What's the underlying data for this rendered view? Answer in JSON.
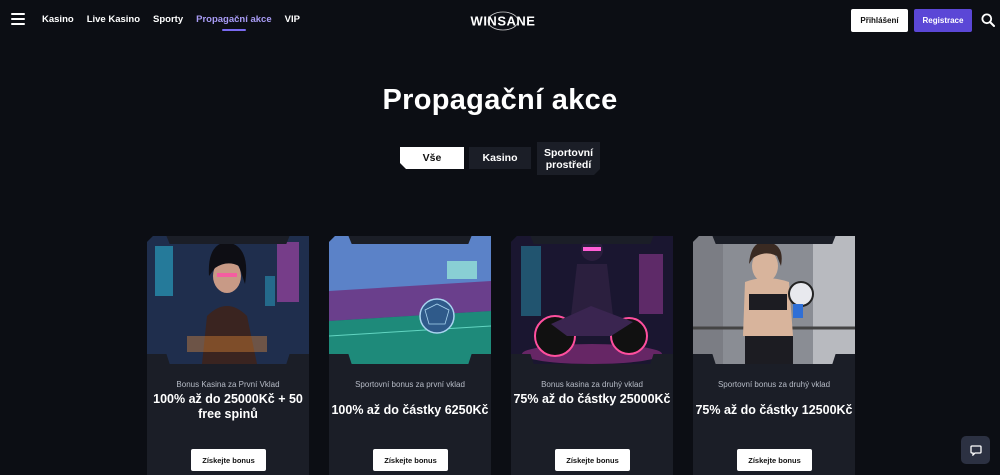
{
  "header": {
    "nav": [
      "Kasino",
      "Live Kasino",
      "Sporty",
      "Propagační akce",
      "VIP"
    ],
    "active_nav": "Propagační akce",
    "logo_text": "WINSANE",
    "login_label": "Přihlášení",
    "register_label": "Registrace",
    "accent_color": "#5b47d6"
  },
  "page": {
    "title": "Propagační akce",
    "tabs": [
      "Vše",
      "Kasino",
      "Sportovní prostředí"
    ],
    "selected_tab": "Vše"
  },
  "promotions": [
    {
      "subtitle": "Bonus Kasina za První Vklad",
      "title": "100% až do 25000Kč + 50 free spinů",
      "button": "Získejte bonus",
      "image": "cyberpunk-woman-casino"
    },
    {
      "subtitle": "Sportovní bonus za první vklad",
      "title": "100% až do částky 6250Kč",
      "button": "Získejte bonus",
      "image": "futuristic-football-stadium"
    },
    {
      "subtitle": "Bonus kasina za druhý vklad",
      "title": "75% až do částky 25000Kč",
      "button": "Získejte bonus",
      "image": "neon-motorcycle-rider"
    },
    {
      "subtitle": "Sportovní bonus za druhý vklad",
      "title": "75% až do částky 12500Kč",
      "button": "Získejte bonus",
      "image": "boxer-woman"
    }
  ],
  "icons": [
    "menu-icon",
    "search-icon",
    "chat-icon"
  ]
}
